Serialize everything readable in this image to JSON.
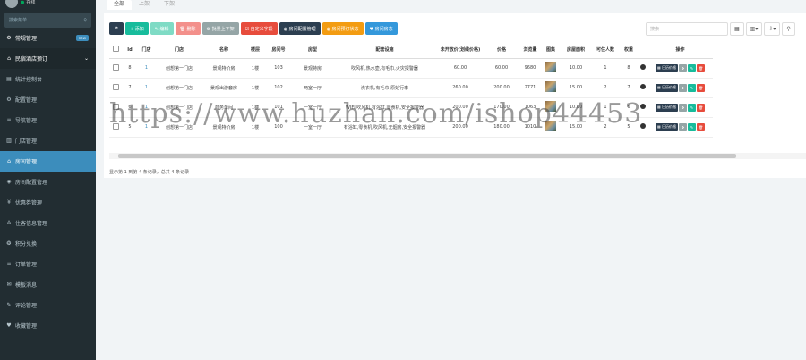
{
  "sidebar": {
    "status": "在线",
    "search_placeholder": "搜索菜单",
    "items": [
      {
        "label": "常规管理",
        "icon": "gears-icon",
        "glyph": "⚙",
        "badge": "new",
        "state": "bold"
      },
      {
        "label": "民宿酒店预订",
        "icon": "home-icon",
        "glyph": "⌂",
        "caret": "⌄",
        "state": "open"
      },
      {
        "label": "统计控制台",
        "icon": "chart-icon",
        "glyph": "▤",
        "state": ""
      },
      {
        "label": "配置管理",
        "icon": "cog-icon",
        "glyph": "⚙",
        "state": ""
      },
      {
        "label": "导航管理",
        "icon": "list-icon",
        "glyph": "≡",
        "state": ""
      },
      {
        "label": "门店管理",
        "icon": "bank-icon",
        "glyph": "▥",
        "state": ""
      },
      {
        "label": "房间管理",
        "icon": "home-icon",
        "glyph": "⌂",
        "state": "active"
      },
      {
        "label": "房间配置管理",
        "icon": "cube-icon",
        "glyph": "◈",
        "state": ""
      },
      {
        "label": "优惠券管理",
        "icon": "yen-icon",
        "glyph": "¥",
        "state": ""
      },
      {
        "label": "住客信息管理",
        "icon": "user-icon",
        "glyph": "♙",
        "state": ""
      },
      {
        "label": "积分兑换",
        "icon": "gift-icon",
        "glyph": "❂",
        "state": ""
      },
      {
        "label": "订单管理",
        "icon": "list-icon",
        "glyph": "≡",
        "state": ""
      },
      {
        "label": "模板消息",
        "icon": "message-icon",
        "glyph": "✉",
        "state": ""
      },
      {
        "label": "评论管理",
        "icon": "comment-icon",
        "glyph": "✎",
        "state": ""
      },
      {
        "label": "收藏管理",
        "icon": "heart-icon",
        "glyph": "♥",
        "state": ""
      }
    ]
  },
  "tabs": [
    "全部",
    "上架",
    "下架"
  ],
  "toolbar": {
    "refresh_icon": "⟳",
    "add": "+ 添加",
    "edit": "✎ 编辑",
    "delete": "🗑 删除",
    "batch": "⚙ 批量上下架",
    "custom": "☑ 自定义字段",
    "room_config": "◉ 房间配置管理",
    "room_orders": "◉ 房间预订状态",
    "room_status": "♥ 房间房态"
  },
  "search_placeholder": "搜索",
  "tool_icons": {
    "toggle": "▦",
    "columns": "▥▾",
    "export": "⇩▾",
    "search": "⚲"
  },
  "columns": [
    "",
    "Id",
    "门店",
    "门店",
    "名称",
    "楼层",
    "房间号",
    "房型",
    "配套设施",
    "未开放价(划线价格)",
    "价格",
    "浏览量",
    "图集",
    "房屋面积",
    "可住人数",
    "权重",
    "",
    "操作"
  ],
  "rows": [
    {
      "id": "8",
      "store_id": "1",
      "store": "创想第一门店",
      "name": "景观特价房",
      "floor": "1楼",
      "room": "103",
      "type": "景观特房",
      "facilities": "吹风机,热水壶,有毛巾,火灾报警器",
      "origin_price": "60.00",
      "price": "60.00",
      "views": "9680",
      "area": "10.00",
      "people": "1",
      "weight": "8"
    },
    {
      "id": "7",
      "store_id": "1",
      "store": "创想第一门店",
      "name": "景观出游套房",
      "floor": "1楼",
      "room": "102",
      "type": "两室一厅",
      "facilities": "洗衣机,有毛巾,原始行李",
      "origin_price": "260.00",
      "price": "200.00",
      "views": "2771",
      "area": "15.00",
      "people": "2",
      "weight": "7"
    },
    {
      "id": "6",
      "store_id": "1",
      "store": "创想第一门店",
      "name": "商务单间",
      "floor": "1楼",
      "room": "101",
      "type": "一室一厅",
      "facilities": "WIFI,吹风机,有浴缸,零食机,安全报警器",
      "origin_price": "200.00",
      "price": "170.00",
      "views": "1063",
      "area": "10.00",
      "people": "1",
      "weight": "6"
    },
    {
      "id": "5",
      "store_id": "1",
      "store": "创想第一门店",
      "name": "景观特价房",
      "floor": "1楼",
      "room": "100",
      "type": "一室一厅",
      "facilities": "有浴缸,零食机,吹风机,无烟房,安全报警器",
      "origin_price": "200.00",
      "price": "180.00",
      "views": "1010",
      "area": "15.00",
      "people": "2",
      "weight": "5"
    }
  ],
  "row_ops": {
    "calendar": "▦ 日历价格",
    "move": "✥",
    "edit": "✎",
    "delete": "🗑"
  },
  "page_info": "显示第 1 到第 4 条记录，总共 4 条记录",
  "watermark": "https://www.huzhan.com/ishop44453"
}
